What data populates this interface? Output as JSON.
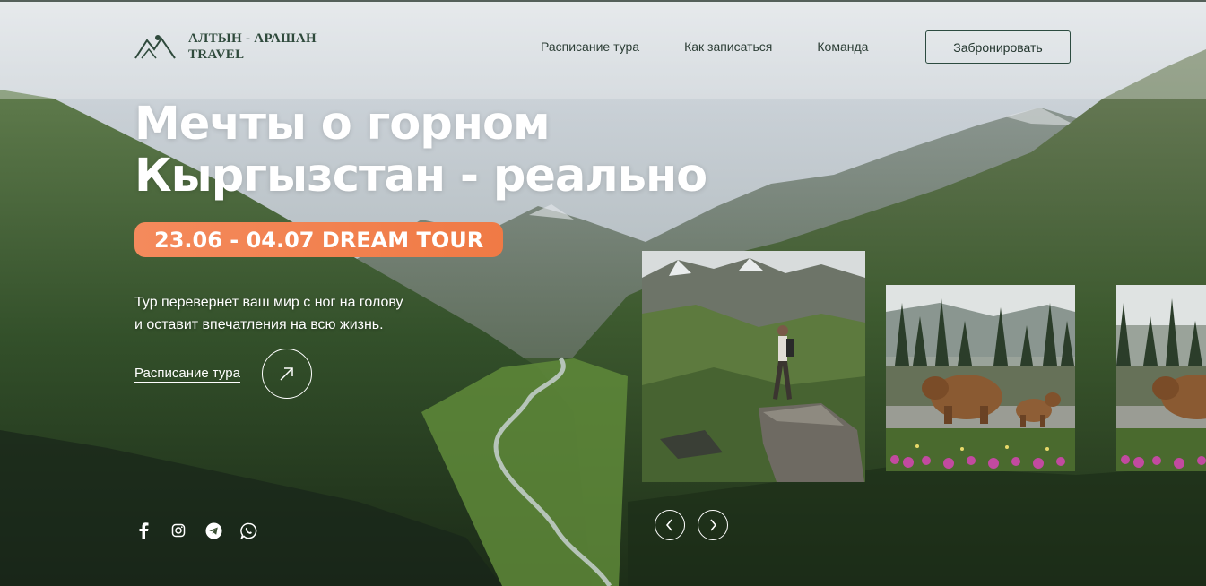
{
  "header": {
    "logo_line1": "АЛТЫН - АРАШАН",
    "logo_line2": "TRAVEL",
    "nav": [
      {
        "label": "Расписание тура"
      },
      {
        "label": "Как записаться"
      },
      {
        "label": "Команда"
      }
    ],
    "book_button": "Забронировать"
  },
  "hero": {
    "title_line1": "Мечты о горном",
    "title_line2": "Кыргызстан - реально",
    "tour_badge": "23.06 - 04.07 DREAM TOUR",
    "description_line1": "Тур перевернет ваш мир с ног на голову",
    "description_line2": "и оставит впечатления на всю жизнь.",
    "schedule_link": "Расписание тура"
  },
  "socials": [
    "facebook-icon",
    "instagram-icon",
    "telegram-icon",
    "whatsapp-icon"
  ],
  "slider": {
    "slides": [
      "hiker-on-rock-photo",
      "bears-in-meadow-photo",
      "bears-in-meadow-photo"
    ]
  },
  "colors": {
    "accent_orange": "#f07a45",
    "logo_green": "#2f4a3c",
    "text_white": "#ffffff"
  }
}
